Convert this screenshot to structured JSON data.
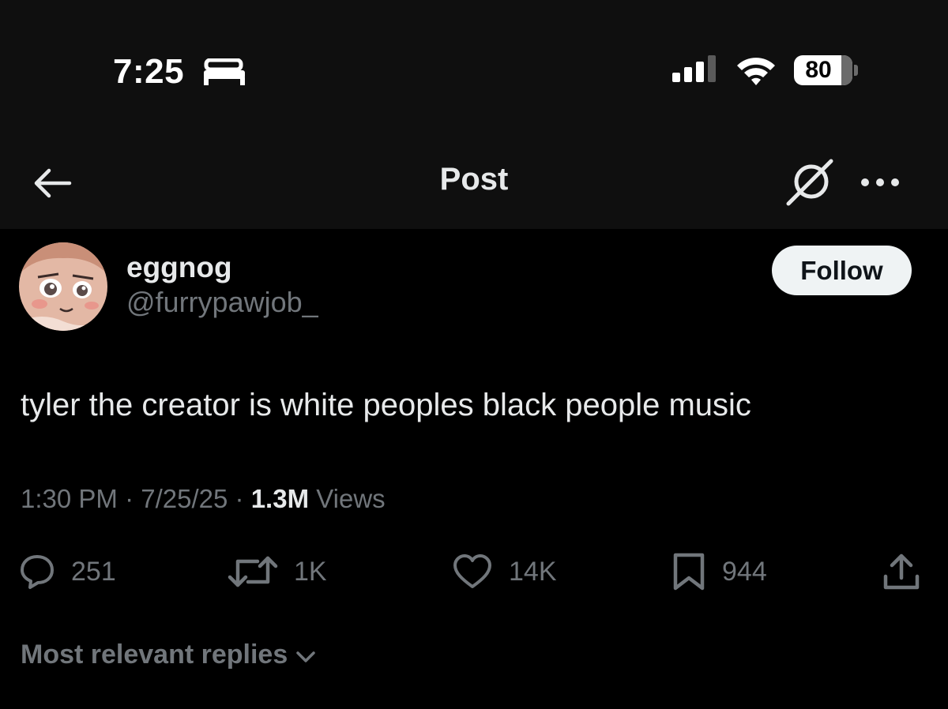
{
  "status_bar": {
    "time": "7:25",
    "battery": "80",
    "icons": [
      "bed-icon",
      "signal-icon",
      "wifi-icon",
      "battery-icon"
    ]
  },
  "header": {
    "title": "Post",
    "icons": [
      "back-arrow-icon",
      "grok-icon",
      "more-icon"
    ]
  },
  "post": {
    "author": {
      "display_name": "eggnog",
      "handle": "@furrypawjob_"
    },
    "follow_label": "Follow",
    "text": "tyler the creator is white peoples black people music",
    "time": "1:30 PM",
    "separator": "·",
    "date": "7/25/25",
    "views_count": "1.3M",
    "views_label": "Views",
    "actions": {
      "replies": "251",
      "reposts": "1K",
      "likes": "14K",
      "bookmarks": "944"
    }
  },
  "replies_filter": {
    "label": "Most relevant replies"
  },
  "colors": {
    "background": "#000000",
    "header_background": "#0f0f0f",
    "primary_text": "#e7e9ea",
    "secondary_text": "#71767b",
    "follow_button": "#eff3f4"
  }
}
